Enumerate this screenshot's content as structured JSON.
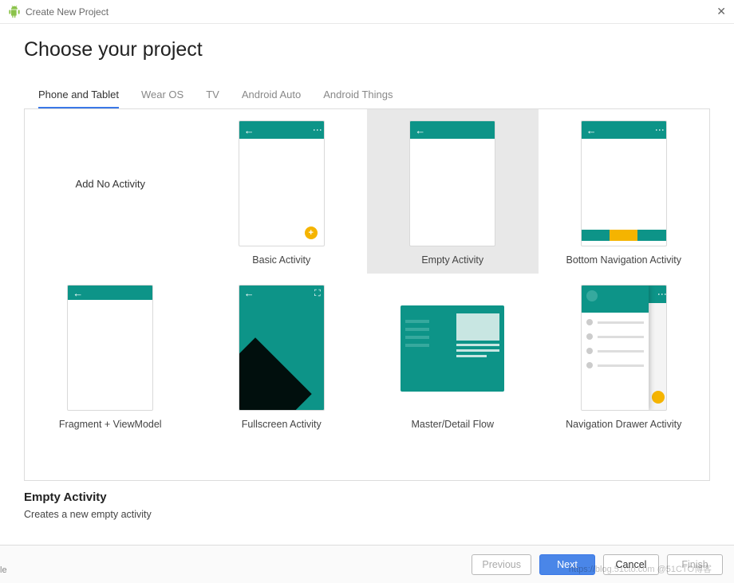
{
  "window": {
    "title": "Create New Project"
  },
  "page": {
    "heading": "Choose your project"
  },
  "tabs": [
    {
      "label": "Phone and Tablet",
      "active": true
    },
    {
      "label": "Wear OS"
    },
    {
      "label": "TV"
    },
    {
      "label": "Android Auto"
    },
    {
      "label": "Android Things"
    }
  ],
  "templates": [
    {
      "label": "Add No Activity",
      "kind": "none"
    },
    {
      "label": "Basic Activity",
      "kind": "basic"
    },
    {
      "label": "Empty Activity",
      "kind": "empty",
      "selected": true
    },
    {
      "label": "Bottom Navigation Activity",
      "kind": "bottomnav"
    },
    {
      "label": "Fragment + ViewModel",
      "kind": "fragvm"
    },
    {
      "label": "Fullscreen Activity",
      "kind": "fullscreen"
    },
    {
      "label": "Master/Detail Flow",
      "kind": "masterdetail"
    },
    {
      "label": "Navigation Drawer Activity",
      "kind": "navdrawer"
    }
  ],
  "selection": {
    "title": "Empty Activity",
    "description": "Creates a new empty activity"
  },
  "footer": {
    "previous": "Previous",
    "next": "Next",
    "cancel": "Cancel",
    "finish": "Finish"
  },
  "watermark": "https://blog.51cto.com @51CTO博客",
  "clip_left": "le"
}
